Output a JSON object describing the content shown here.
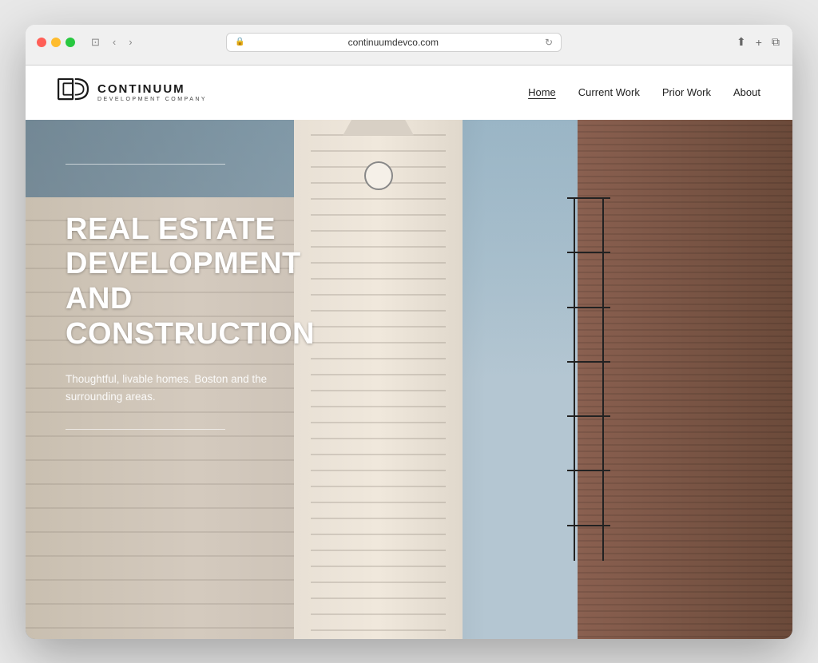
{
  "browser": {
    "url": "continuumdevco.com",
    "back_label": "‹",
    "forward_label": "›",
    "sidebar_label": "⊞",
    "share_label": "⎋",
    "new_tab_label": "+",
    "windows_label": "⧉"
  },
  "site": {
    "logo": {
      "name": "CONTINUUM",
      "sub": "DEVELOPMENT COMPANY",
      "icon_label": "CD"
    },
    "nav": {
      "home": "Home",
      "current_work": "Current Work",
      "prior_work": "Prior Work",
      "about": "About"
    },
    "hero": {
      "heading_line1": "REAL ESTATE",
      "heading_line2": "DEVELOPMENT",
      "heading_line3": "AND CONSTRUCTION",
      "subtext": "Thoughtful, livable homes. Boston and the surrounding areas."
    }
  }
}
